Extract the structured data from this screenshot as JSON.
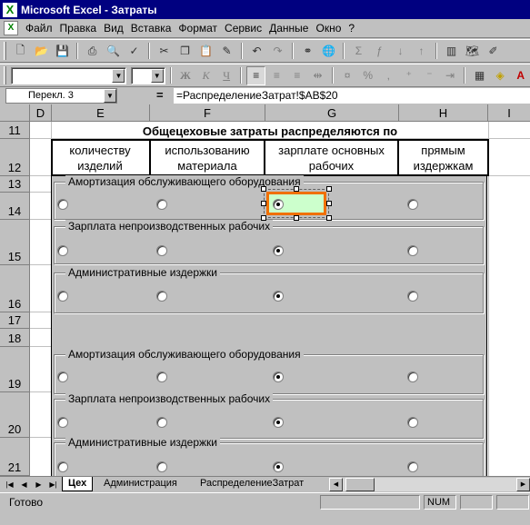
{
  "window": {
    "title": "Microsoft Excel - Затраты"
  },
  "menu": {
    "items": [
      "Файл",
      "Правка",
      "Вид",
      "Вставка",
      "Формат",
      "Сервис",
      "Данные",
      "Окно",
      "?"
    ]
  },
  "toolbar1": {
    "icons": [
      "new-icon",
      "open-icon",
      "save-icon",
      "print-icon",
      "print-preview-icon",
      "spelling-icon",
      "cut-icon",
      "copy-icon",
      "paste-icon",
      "format-painter-icon",
      "undo-icon",
      "redo-icon",
      "hyperlink-icon",
      "web-icon",
      "autosum-icon",
      "function-icon",
      "sort-asc-icon",
      "sort-desc-icon",
      "chart-wizard-icon",
      "map-icon",
      "drawing-icon"
    ]
  },
  "toolbar2": {
    "font_value": "",
    "size_value": "",
    "bold": "Ж",
    "italic": "К",
    "underline": "Ч",
    "percent": "%",
    "comma": ",",
    "font_color_letter": "A"
  },
  "formula_bar": {
    "name_box": "Перекл. 3",
    "equals": "=",
    "formula": "=РаспределениеЗатрат!$AB$20"
  },
  "sheet": {
    "columns": [
      "D",
      "E",
      "F",
      "G",
      "H",
      "I"
    ],
    "rows": [
      "11",
      "12",
      "13",
      "14",
      "15",
      "16",
      "17",
      "18",
      "19",
      "20",
      "21"
    ],
    "title": "Общецеховые затраты распределяются по",
    "headers": [
      "количеству изделий",
      "использованию материала",
      "зарплате основных рабочих",
      "прямым издержкам"
    ],
    "groups": [
      {
        "legend": "Амортизация обслуживающего оборудования",
        "selected": 2
      },
      {
        "legend": "Зарплата непроизводственных рабочих",
        "selected": 2
      },
      {
        "legend": "Административные издержки",
        "selected": 2
      },
      {
        "legend": "Амортизация обслуживающего оборудования",
        "selected": 2
      },
      {
        "legend": "Зарплата непроизводственных рабочих",
        "selected": 2
      },
      {
        "legend": "Административные издержки",
        "selected": 2
      }
    ]
  },
  "tabs": {
    "items": [
      "Цех",
      "Администрация",
      "РаспределениеЗатрат"
    ],
    "active": "Цех"
  },
  "status": {
    "text": "Готово",
    "num": "NUM"
  },
  "colors": {
    "title_bar": "#000080",
    "selection_border": "#f07000",
    "selection_fill": "#ccffcc",
    "chrome": "#c0c0c0"
  }
}
